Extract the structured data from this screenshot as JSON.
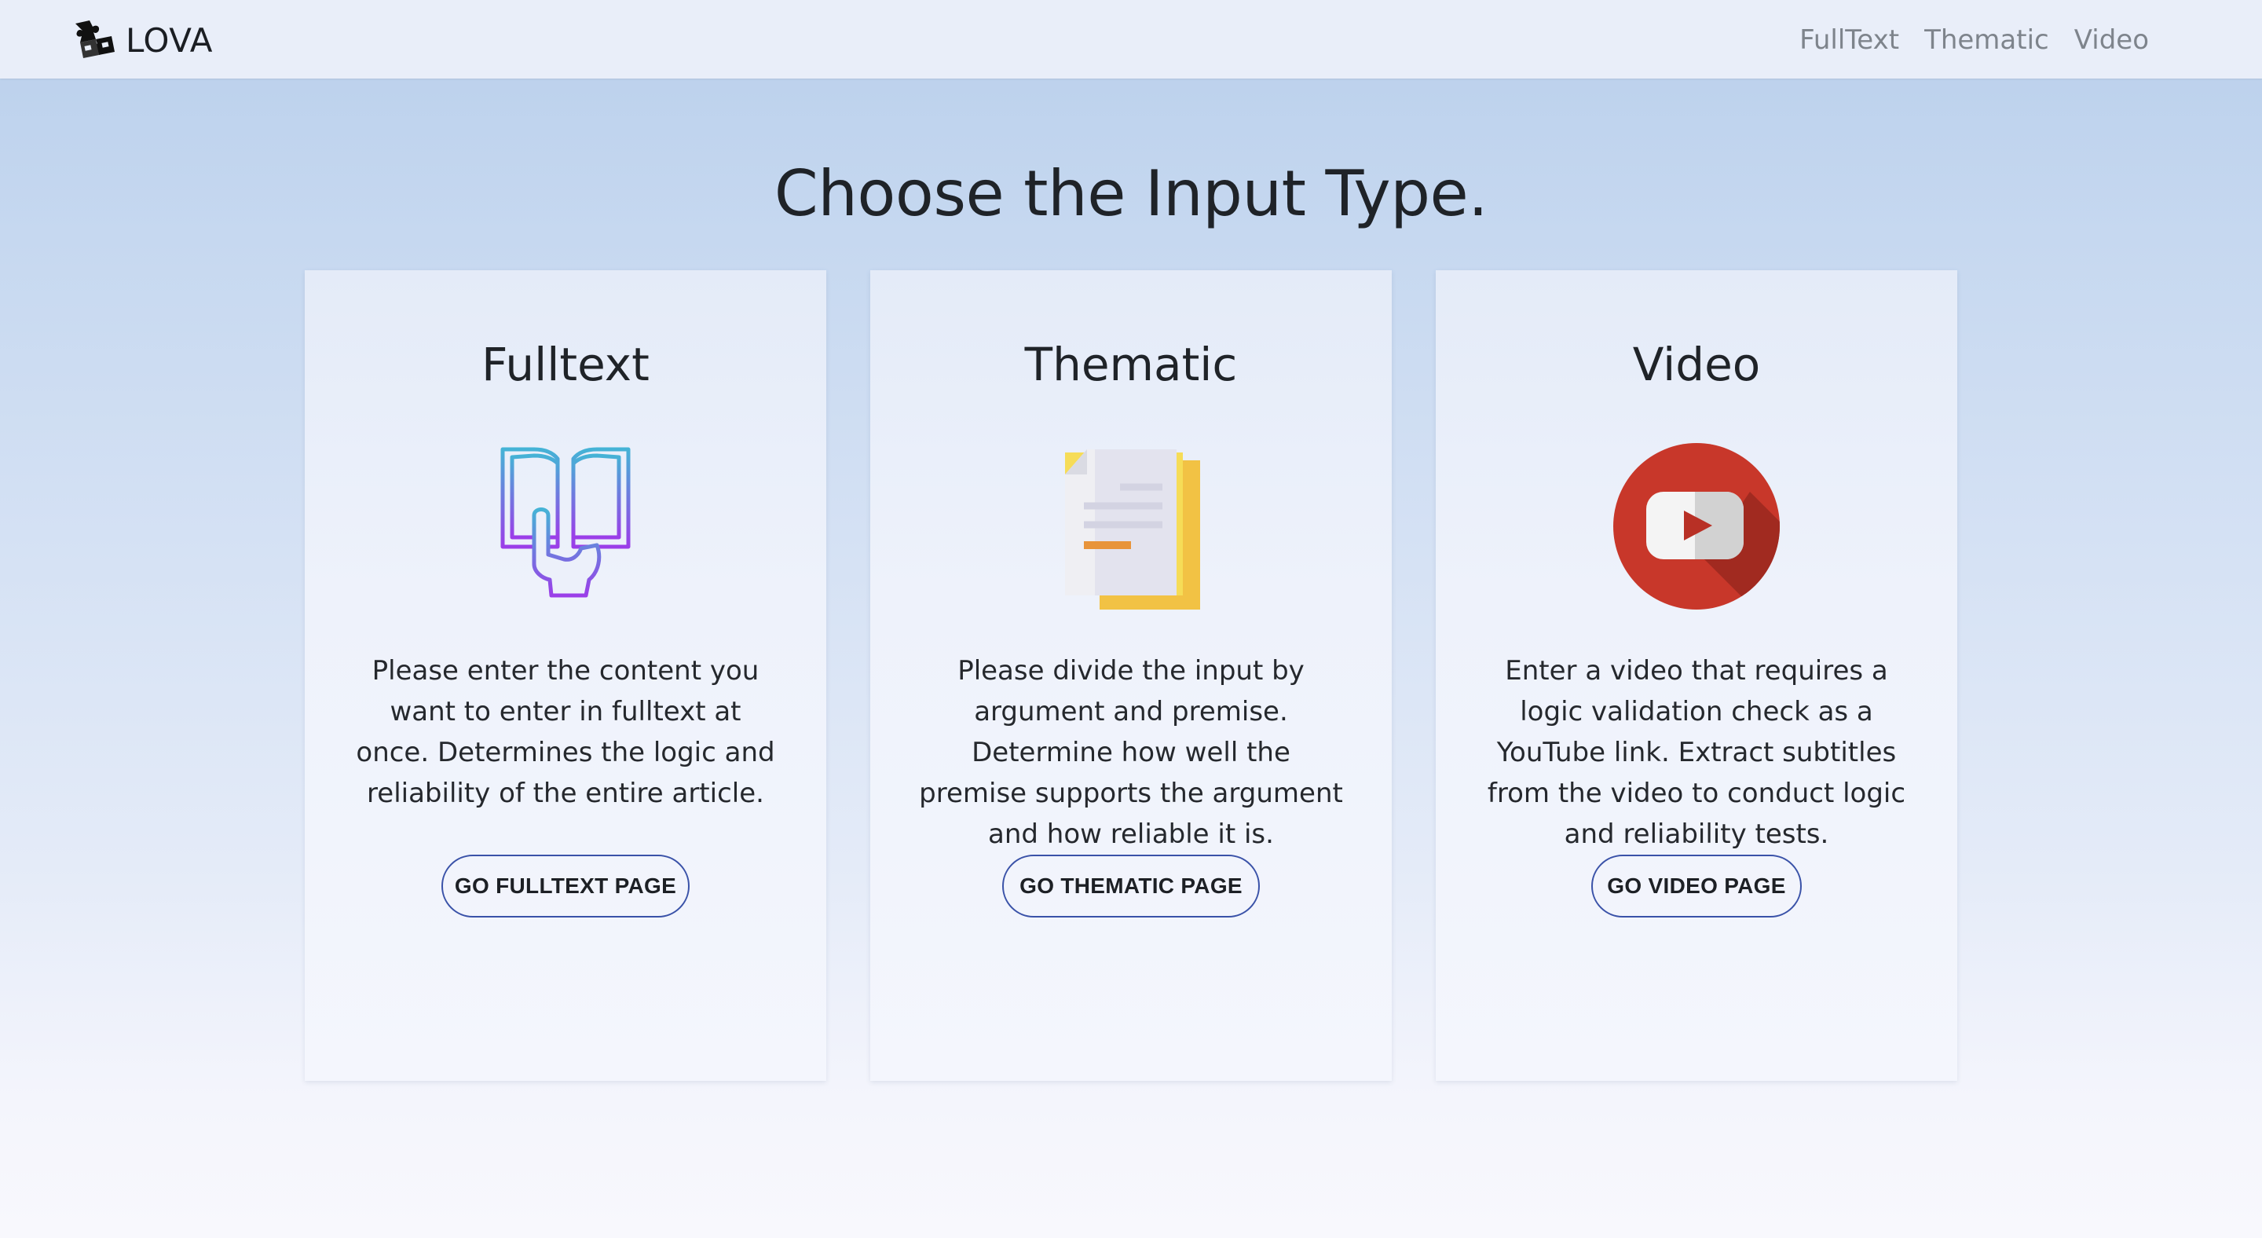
{
  "brand": {
    "name": "LOVA",
    "icon": "puzzle-icon"
  },
  "nav": {
    "items": [
      "FullText",
      "Thematic",
      "Video"
    ]
  },
  "heading": "Choose the Input Type.",
  "cards": [
    {
      "title": "Fulltext",
      "icon": "book-reading-icon",
      "description": "Please enter the content you want to enter in fulltext at once. Determines the logic and reliability of the entire article.",
      "button": "GO FULLTEXT PAGE"
    },
    {
      "title": "Thematic",
      "icon": "documents-icon",
      "description": "Please divide the input by argument and premise. Determine how well the premise supports the argument and how reliable it is.",
      "button": "GO THEMATIC PAGE"
    },
    {
      "title": "Video",
      "icon": "youtube-play-icon",
      "description": "Enter a video that requires a logic validation check as a YouTube link. Extract subtitles from the video to conduct logic and reliability tests.",
      "button": "GO VIDEO PAGE"
    }
  ],
  "colors": {
    "button_border": "#3a52a8",
    "navbar_bg": "#e9eef9",
    "youtube_red": "#c8372a"
  }
}
